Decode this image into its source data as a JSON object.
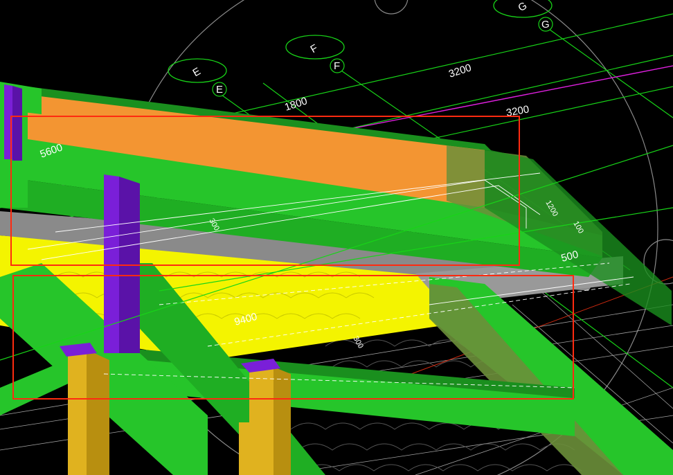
{
  "viewport": {
    "background": "#000000",
    "colors": {
      "beam_green": "#26c52a",
      "beam_green_dark": "#1a8f1e",
      "beam_green_shade": "#6b8f3a",
      "column_purple": "#7a1fd8",
      "column_yellow": "#e0b21f",
      "orange_panel": "#f39532",
      "yellow_slab": "#f4f400",
      "gray_slab": "#8a8a8a",
      "axis_green": "#18d418",
      "axis_magenta": "#e020e0",
      "selection_red": "#ff2a10",
      "line_white": "#ffffff",
      "orbit_gray": "#9a9a9a"
    },
    "grid_axes": [
      {
        "name": "E",
        "label": "E"
      },
      {
        "name": "F",
        "label": "F"
      },
      {
        "name": "G",
        "label": "G"
      }
    ],
    "dimensions": [
      {
        "label": "5600"
      },
      {
        "label": "1800"
      },
      {
        "label": "3200"
      },
      {
        "label": "3200"
      },
      {
        "label": "500"
      },
      {
        "label": "9400"
      },
      {
        "label": "300"
      },
      {
        "label": "300"
      },
      {
        "label": "1200"
      },
      {
        "label": "100"
      }
    ],
    "selection_boxes": [
      {
        "name": "upper-beam-selection"
      },
      {
        "name": "lower-beam-selection"
      }
    ]
  }
}
